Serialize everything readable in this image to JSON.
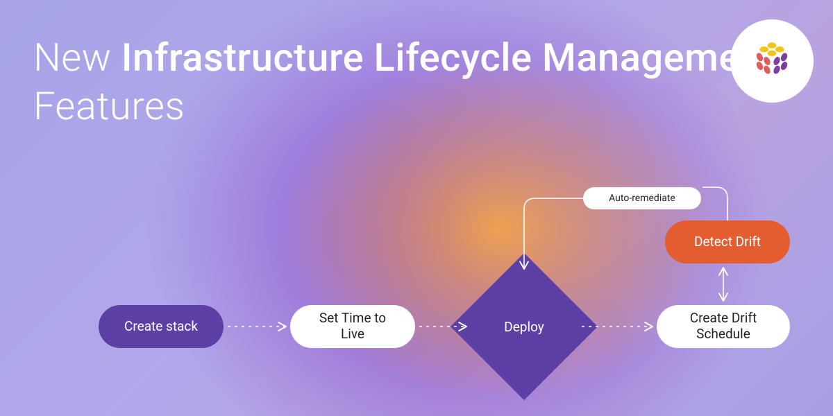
{
  "heading": {
    "prefix": "New ",
    "bold": "Infrastructure Lifecycle Management",
    "suffix": " Features"
  },
  "logo": {
    "name": "pulumi-logo"
  },
  "flow": {
    "create_stack": "Create stack",
    "set_ttl": "Set Time to Live",
    "deploy": "Deploy",
    "drift_schedule": "Create Drift Schedule",
    "detect_drift": "Detect Drift",
    "auto_remediate": "Auto-remediate"
  },
  "colors": {
    "purple": "#5d40a6",
    "orange": "#e35d31",
    "white": "#ffffff"
  }
}
